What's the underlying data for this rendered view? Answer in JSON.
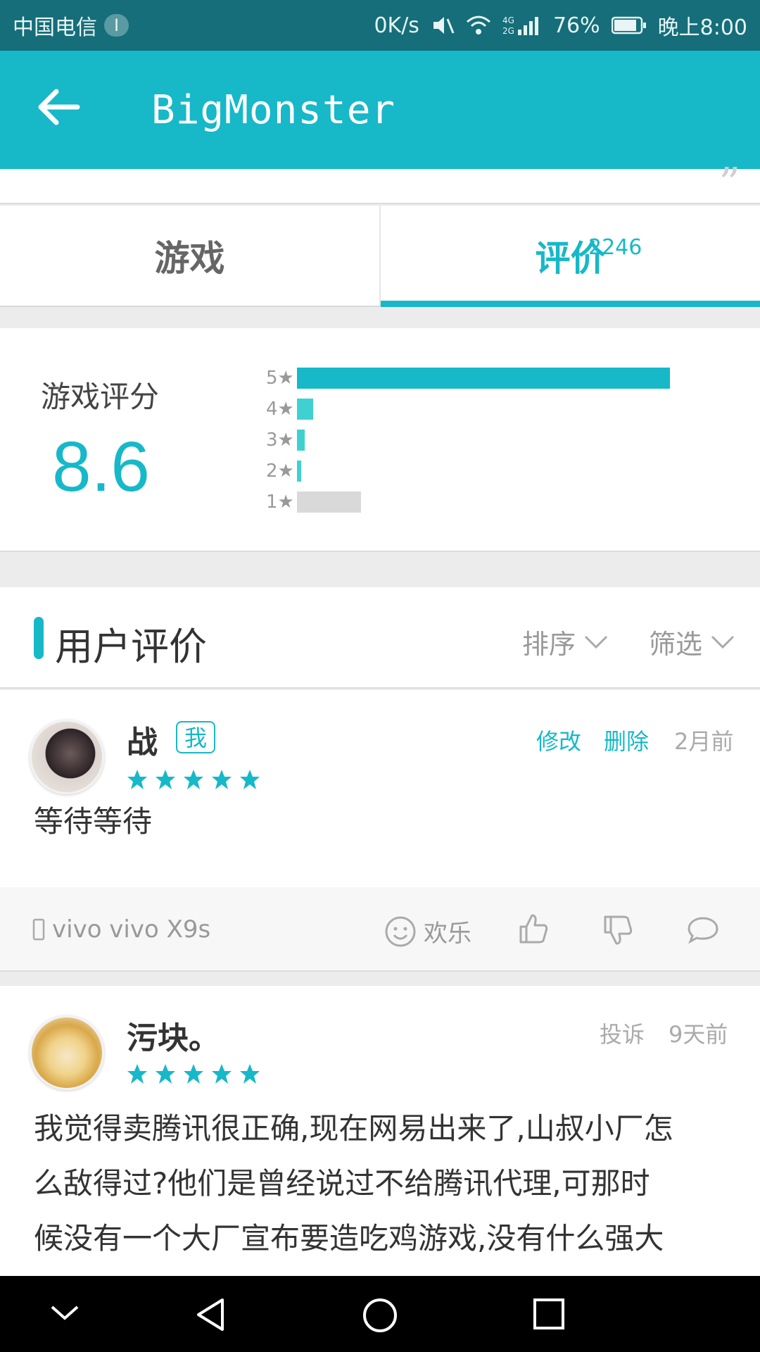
{
  "status_bar": {
    "carrier": "中国电信",
    "sim_badge": "I",
    "net_speed": "0K/s",
    "network": "4G 2G",
    "battery": "76%",
    "time": "晚上8:00"
  },
  "app_bar": {
    "title": "BigMonster"
  },
  "tabs": [
    {
      "label": "游戏",
      "active": false
    },
    {
      "label": "评价",
      "count": "2246",
      "active": true
    }
  ],
  "rating": {
    "title": "游戏评分",
    "score": "8.6",
    "distribution": [
      {
        "label": "5★",
        "fraction": 0.93
      },
      {
        "label": "4★",
        "fraction": 0.04
      },
      {
        "label": "3★",
        "fraction": 0.02
      },
      {
        "label": "2★",
        "fraction": 0.01
      },
      {
        "label": "1★",
        "fraction": 0.16
      }
    ]
  },
  "reviews_header": {
    "title": "用户评价",
    "sort_label": "排序",
    "filter_label": "筛选"
  },
  "reviews": [
    {
      "name": "战",
      "badge": "我",
      "stars": 5,
      "edit_label": "修改",
      "delete_label": "删除",
      "time": "2月前",
      "text": "等待等待",
      "device": "vivo vivo X9s",
      "emotion": "欢乐"
    },
    {
      "name": "污块。",
      "stars": 5,
      "report_label": "投诉",
      "time": "9天前",
      "text_lines": [
        "我觉得卖腾讯很正确,现在网易出来了,山叔小厂怎",
        "么敌得过?他们是曾经说过不给腾讯代理,可那时",
        "候没有一个大厂宣布要造吃鸡游戏,没有什么强大"
      ]
    }
  ],
  "colors": {
    "accent": "#17b8c8",
    "status_bar": "#156e79",
    "bar_5": "#17b8c8",
    "bar_mid": "#3fd0d0",
    "bar_1": "#d9d9d9"
  }
}
